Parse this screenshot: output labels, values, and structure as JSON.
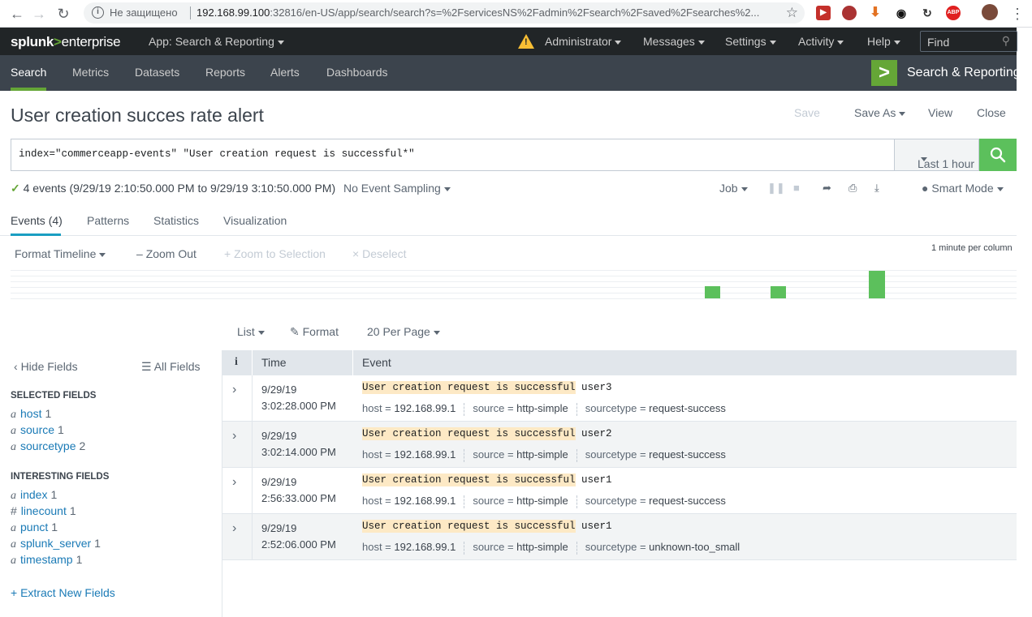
{
  "browser": {
    "security": "Не защищено",
    "url_host": "192.168.99.100",
    "url_rest": ":32816/en-US/app/search/search?s=%2FservicesNS%2Fadmin%2Fsearch%2Fsaved%2Fsearches%2..."
  },
  "topbar": {
    "logo_splunk": "splunk",
    "logo_gt": ">",
    "logo_enterprise": "enterprise",
    "app": "App: Search & Reporting",
    "user": "Administrator",
    "messages": "Messages",
    "settings": "Settings",
    "activity": "Activity",
    "help": "Help",
    "find_placeholder": "Find"
  },
  "appnav": {
    "items": [
      "Search",
      "Metrics",
      "Datasets",
      "Reports",
      "Alerts",
      "Dashboards"
    ],
    "app_title": "Search & Reporting"
  },
  "page": {
    "title": "User creation succes rate alert",
    "save": "Save",
    "save_as": "Save As",
    "view": "View",
    "close": "Close"
  },
  "search": {
    "query": "index=\"commerceapp-events\" \"User creation request is successful*\"",
    "time_range": "Last 1 hour"
  },
  "status": {
    "summary": "4 events (9/29/19 2:10:50.000 PM to 9/29/19 3:10:50.000 PM)",
    "sampling": "No Event Sampling",
    "job": "Job",
    "mode": "Smart Mode"
  },
  "tabs": [
    "Events (4)",
    "Patterns",
    "Statistics",
    "Visualization"
  ],
  "timeline": {
    "format": "Format Timeline",
    "zoom_out": "Zoom Out",
    "zoom_selection": "Zoom to Selection",
    "deselect": "Deselect",
    "scale": "1 minute per column",
    "bucket_counts": [
      1,
      1,
      2
    ]
  },
  "results_controls": {
    "list": "List",
    "format": "Format",
    "per_page": "20 Per Page"
  },
  "sidebar": {
    "hide_fields": "Hide Fields",
    "all_fields": "All Fields",
    "selected_heading": "SELECTED FIELDS",
    "selected": [
      {
        "type": "a",
        "name": "host",
        "count": "1"
      },
      {
        "type": "a",
        "name": "source",
        "count": "1"
      },
      {
        "type": "a",
        "name": "sourcetype",
        "count": "2"
      }
    ],
    "interesting_heading": "INTERESTING FIELDS",
    "interesting": [
      {
        "type": "a",
        "name": "index",
        "count": "1"
      },
      {
        "type": "#",
        "name": "linecount",
        "count": "1"
      },
      {
        "type": "a",
        "name": "punct",
        "count": "1"
      },
      {
        "type": "a",
        "name": "splunk_server",
        "count": "1"
      },
      {
        "type": "a",
        "name": "timestamp",
        "count": "1"
      }
    ],
    "extract": "+ Extract New Fields"
  },
  "table": {
    "col_info": "i",
    "col_time": "Time",
    "col_event": "Event",
    "rows": [
      {
        "date": "9/29/19",
        "time": "3:02:28.000 PM",
        "match": "User creation request is successful",
        "rest": " user3",
        "host": "192.168.99.1",
        "source": "http-simple",
        "sourcetype": "request-success"
      },
      {
        "date": "9/29/19",
        "time": "3:02:14.000 PM",
        "match": "User creation request is successful",
        "rest": " user2",
        "host": "192.168.99.1",
        "source": "http-simple",
        "sourcetype": "request-success"
      },
      {
        "date": "9/29/19",
        "time": "2:56:33.000 PM",
        "match": "User creation request is successful",
        "rest": " user1",
        "host": "192.168.99.1",
        "source": "http-simple",
        "sourcetype": "request-success"
      },
      {
        "date": "9/29/19",
        "time": "2:52:06.000 PM",
        "match": "User creation request is successful",
        "rest": " user1",
        "host": "192.168.99.1",
        "source": "http-simple",
        "sourcetype": "unknown-too_small"
      }
    ],
    "labels": {
      "host": "host =",
      "source": "source =",
      "sourcetype": "sourcetype ="
    }
  }
}
